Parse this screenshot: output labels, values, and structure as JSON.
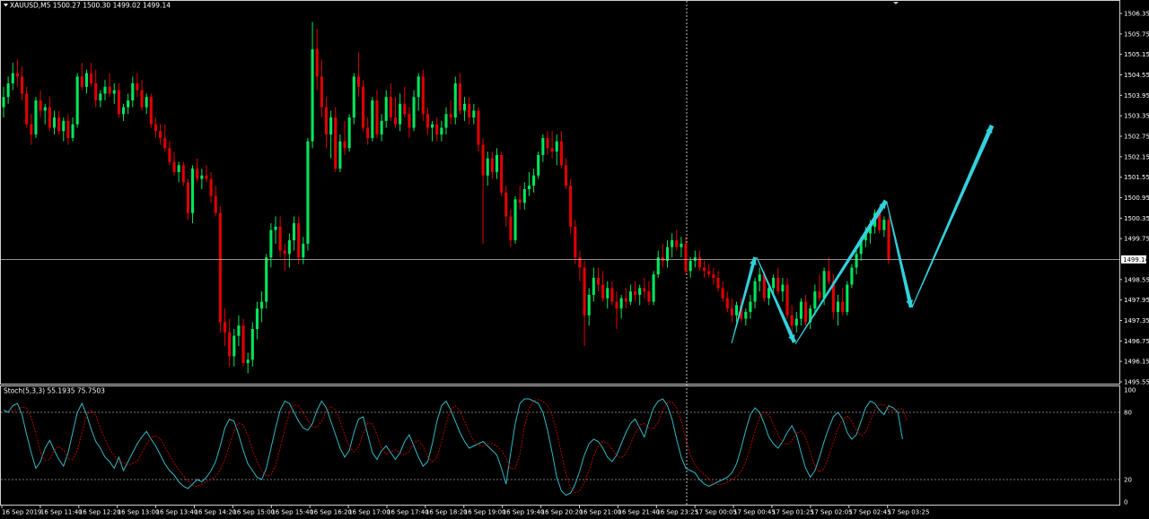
{
  "window": {
    "symbol_header": "XAUUSD,M5  1500.27 1500.30 1499.02 1499.14"
  },
  "colors": {
    "background": "#000000",
    "grid_frame": "#d0d0d0",
    "bull_candle": "#00e65c",
    "bear_candle": "#e00000",
    "price_line": "#c0c0c0",
    "crosshair": "#c0c0c0",
    "arrow": "#33d1de",
    "stoch_main": "#33b8c4",
    "stoch_signal": "#e00000",
    "bid_box": "#ffffff"
  },
  "main_panel": {
    "current_price_label": "1499.14",
    "price_axis_labels": [
      "1506.35",
      "1505.75",
      "1505.15",
      "1504.55",
      "1503.95",
      "1503.35",
      "1502.75",
      "1502.15",
      "1501.55",
      "1500.95",
      "1500.35",
      "1499.75",
      "1498.55",
      "1497.95",
      "1497.35",
      "1496.75",
      "1496.15",
      "1495.55"
    ],
    "annotation": "hand-drawn cyan zigzag arrow projection (down, up, down, up)"
  },
  "stoch_panel": {
    "header": "Stoch(5,3,3) 55.1935 75.7503",
    "axis_labels": [
      "100",
      "80",
      "20",
      "0"
    ]
  },
  "time_axis": {
    "labels": [
      "16 Sep 2019",
      "16 Sep 11:40",
      "16 Sep 12:20",
      "16 Sep 13:00",
      "16 Sep 13:40",
      "16 Sep 14:20",
      "16 Sep 15:00",
      "16 Sep 15:40",
      "16 Sep 16:20",
      "16 Sep 17:00",
      "16 Sep 17:40",
      "16 Sep 18:20",
      "16 Sep 19:00",
      "16 Sep 19:40",
      "16 Sep 20:20",
      "16 Sep 21:00",
      "16 Sep 21:40",
      "16 Sep 23:25",
      "17 Sep 00:05",
      "17 Sep 00:45",
      "17 Sep 01:25",
      "17 Sep 02:05",
      "17 Sep 02:45",
      "17 Sep 03:25"
    ]
  },
  "chart_data": {
    "type": "candlestick",
    "symbol": "XAUUSD",
    "timeframe": "M5",
    "ylim": [
      1495.55,
      1506.55
    ],
    "stoch_ylim": [
      0,
      100
    ],
    "stoch_levels": [
      80,
      20
    ],
    "ohlc": [
      [
        1503.6,
        1504.2,
        1503.3,
        1503.9
      ],
      [
        1503.9,
        1504.5,
        1503.7,
        1504.3
      ],
      [
        1504.3,
        1504.9,
        1504.1,
        1504.6
      ],
      [
        1504.6,
        1505.0,
        1504.2,
        1504.5
      ],
      [
        1504.5,
        1504.8,
        1503.8,
        1504.0
      ],
      [
        1504.0,
        1504.2,
        1503.0,
        1503.1
      ],
      [
        1503.1,
        1503.4,
        1502.5,
        1502.8
      ],
      [
        1502.8,
        1503.9,
        1502.7,
        1503.8
      ],
      [
        1503.8,
        1504.1,
        1503.3,
        1503.5
      ],
      [
        1503.5,
        1503.7,
        1503.1,
        1503.6
      ],
      [
        1503.6,
        1503.9,
        1502.9,
        1503.0
      ],
      [
        1503.0,
        1503.5,
        1502.8,
        1503.3
      ],
      [
        1503.3,
        1503.5,
        1502.8,
        1502.9
      ],
      [
        1502.9,
        1503.3,
        1502.6,
        1503.2
      ],
      [
        1503.2,
        1503.4,
        1502.5,
        1502.7
      ],
      [
        1502.7,
        1503.3,
        1502.6,
        1503.1
      ],
      [
        1503.1,
        1504.6,
        1503.0,
        1504.5
      ],
      [
        1504.5,
        1504.9,
        1504.1,
        1504.2
      ],
      [
        1504.2,
        1504.7,
        1504.0,
        1504.6
      ],
      [
        1504.6,
        1504.9,
        1504.2,
        1504.3
      ],
      [
        1504.3,
        1504.7,
        1503.6,
        1503.8
      ],
      [
        1503.8,
        1504.1,
        1503.6,
        1504.0
      ],
      [
        1504.0,
        1504.4,
        1503.8,
        1504.2
      ],
      [
        1504.2,
        1504.6,
        1503.9,
        1504.0
      ],
      [
        1504.0,
        1504.3,
        1503.7,
        1504.1
      ],
      [
        1504.1,
        1504.3,
        1503.3,
        1503.4
      ],
      [
        1503.4,
        1503.7,
        1503.2,
        1503.6
      ],
      [
        1503.6,
        1504.0,
        1503.4,
        1503.8
      ],
      [
        1503.8,
        1504.5,
        1503.6,
        1504.3
      ],
      [
        1504.3,
        1504.6,
        1503.9,
        1504.1
      ],
      [
        1504.1,
        1504.4,
        1503.5,
        1503.6
      ],
      [
        1503.6,
        1504.0,
        1503.4,
        1503.9
      ],
      [
        1503.9,
        1504.0,
        1503.0,
        1503.1
      ],
      [
        1503.1,
        1503.3,
        1502.7,
        1502.9
      ],
      [
        1502.9,
        1503.1,
        1502.5,
        1502.7
      ],
      [
        1502.7,
        1503.1,
        1502.3,
        1502.4
      ],
      [
        1502.4,
        1502.6,
        1501.9,
        1502.0
      ],
      [
        1502.0,
        1502.3,
        1501.6,
        1501.7
      ],
      [
        1501.7,
        1502.0,
        1501.4,
        1501.9
      ],
      [
        1501.9,
        1502.0,
        1501.3,
        1501.4
      ],
      [
        1501.4,
        1501.5,
        1500.3,
        1500.5
      ],
      [
        1500.5,
        1501.9,
        1500.2,
        1501.8
      ],
      [
        1501.8,
        1502.1,
        1501.4,
        1501.5
      ],
      [
        1501.5,
        1501.8,
        1501.2,
        1501.6
      ],
      [
        1501.6,
        1501.9,
        1501.4,
        1501.5
      ],
      [
        1501.5,
        1501.7,
        1500.8,
        1501.0
      ],
      [
        1501.0,
        1501.3,
        1500.4,
        1500.5
      ],
      [
        1500.5,
        1500.7,
        1497.0,
        1497.3
      ],
      [
        1497.3,
        1497.7,
        1496.6,
        1497.0
      ],
      [
        1497.0,
        1497.4,
        1496.0,
        1496.3
      ],
      [
        1496.3,
        1497.1,
        1496.0,
        1496.9
      ],
      [
        1496.9,
        1497.5,
        1496.6,
        1497.2
      ],
      [
        1497.2,
        1497.4,
        1496.0,
        1496.1
      ],
      [
        1496.1,
        1496.4,
        1495.8,
        1496.2
      ],
      [
        1496.2,
        1497.3,
        1496.0,
        1497.1
      ],
      [
        1497.1,
        1497.9,
        1496.8,
        1497.7
      ],
      [
        1497.7,
        1498.2,
        1497.3,
        1497.9
      ],
      [
        1497.9,
        1499.3,
        1497.7,
        1499.2
      ],
      [
        1499.2,
        1500.2,
        1498.9,
        1500.0
      ],
      [
        1500.0,
        1500.4,
        1499.6,
        1500.1
      ],
      [
        1500.1,
        1500.4,
        1499.2,
        1499.4
      ],
      [
        1499.4,
        1499.6,
        1498.8,
        1499.3
      ],
      [
        1499.3,
        1499.9,
        1498.9,
        1499.7
      ],
      [
        1499.7,
        1500.4,
        1499.4,
        1500.2
      ],
      [
        1500.2,
        1500.4,
        1499.0,
        1499.2
      ],
      [
        1499.2,
        1499.8,
        1499.0,
        1499.6
      ],
      [
        1499.6,
        1502.7,
        1499.4,
        1502.6
      ],
      [
        1502.6,
        1506.1,
        1502.4,
        1505.3
      ],
      [
        1505.3,
        1505.9,
        1504.1,
        1504.5
      ],
      [
        1504.5,
        1505.0,
        1503.3,
        1503.6
      ],
      [
        1503.6,
        1503.9,
        1502.4,
        1502.8
      ],
      [
        1502.8,
        1503.5,
        1502.1,
        1503.3
      ],
      [
        1503.3,
        1503.6,
        1501.7,
        1501.8
      ],
      [
        1501.8,
        1502.8,
        1501.7,
        1502.6
      ],
      [
        1502.6,
        1503.2,
        1502.2,
        1502.4
      ],
      [
        1502.4,
        1503.4,
        1502.3,
        1503.3
      ],
      [
        1503.3,
        1504.6,
        1503.1,
        1504.5
      ],
      [
        1504.5,
        1505.2,
        1503.9,
        1504.2
      ],
      [
        1504.2,
        1504.4,
        1502.9,
        1503.0
      ],
      [
        1503.0,
        1503.3,
        1502.5,
        1502.7
      ],
      [
        1502.7,
        1503.9,
        1502.6,
        1503.8
      ],
      [
        1503.8,
        1504.1,
        1502.7,
        1502.8
      ],
      [
        1502.8,
        1503.4,
        1502.6,
        1503.2
      ],
      [
        1503.2,
        1504.1,
        1503.0,
        1503.9
      ],
      [
        1503.9,
        1504.3,
        1503.2,
        1503.3
      ],
      [
        1503.3,
        1503.9,
        1503.0,
        1503.1
      ],
      [
        1503.1,
        1504.0,
        1502.9,
        1503.7
      ],
      [
        1503.7,
        1504.2,
        1503.3,
        1503.4
      ],
      [
        1503.4,
        1503.6,
        1502.7,
        1503.0
      ],
      [
        1503.0,
        1504.1,
        1502.9,
        1503.9
      ],
      [
        1503.9,
        1504.6,
        1503.5,
        1504.5
      ],
      [
        1504.5,
        1504.7,
        1503.2,
        1503.4
      ],
      [
        1503.4,
        1503.6,
        1502.8,
        1503.0
      ],
      [
        1503.0,
        1503.2,
        1502.6,
        1503.1
      ],
      [
        1503.1,
        1503.3,
        1502.6,
        1502.8
      ],
      [
        1502.8,
        1503.2,
        1502.6,
        1503.0
      ],
      [
        1503.0,
        1503.6,
        1502.8,
        1503.4
      ],
      [
        1503.4,
        1503.8,
        1503.1,
        1503.3
      ],
      [
        1503.3,
        1504.5,
        1503.1,
        1504.3
      ],
      [
        1504.3,
        1504.6,
        1503.4,
        1503.5
      ],
      [
        1503.5,
        1503.9,
        1503.2,
        1503.7
      ],
      [
        1503.7,
        1503.9,
        1503.1,
        1503.3
      ],
      [
        1503.3,
        1503.7,
        1503.1,
        1503.5
      ],
      [
        1503.5,
        1503.6,
        1502.3,
        1502.5
      ],
      [
        1502.5,
        1502.7,
        1499.6,
        1501.6
      ],
      [
        1501.6,
        1502.3,
        1501.3,
        1502.1
      ],
      [
        1502.1,
        1502.3,
        1501.5,
        1501.7
      ],
      [
        1501.7,
        1502.4,
        1501.5,
        1502.2
      ],
      [
        1502.2,
        1502.3,
        1501.0,
        1501.1
      ],
      [
        1501.1,
        1501.3,
        1500.1,
        1500.4
      ],
      [
        1500.4,
        1500.6,
        1499.5,
        1499.7
      ],
      [
        1499.7,
        1501.0,
        1499.6,
        1500.9
      ],
      [
        1500.9,
        1501.3,
        1500.6,
        1500.8
      ],
      [
        1500.8,
        1501.4,
        1500.6,
        1501.2
      ],
      [
        1501.2,
        1501.7,
        1501.0,
        1501.3
      ],
      [
        1501.3,
        1501.8,
        1501.1,
        1501.6
      ],
      [
        1501.6,
        1502.3,
        1501.5,
        1502.2
      ],
      [
        1502.2,
        1502.8,
        1502.0,
        1502.7
      ],
      [
        1502.7,
        1502.9,
        1502.2,
        1502.4
      ],
      [
        1502.4,
        1502.9,
        1502.1,
        1502.3
      ],
      [
        1502.3,
        1502.8,
        1501.9,
        1502.6
      ],
      [
        1502.6,
        1502.9,
        1501.8,
        1501.9
      ],
      [
        1501.9,
        1502.1,
        1501.2,
        1501.3
      ],
      [
        1501.3,
        1501.5,
        1499.9,
        1500.1
      ],
      [
        1500.1,
        1500.3,
        1499.0,
        1499.2
      ],
      [
        1499.2,
        1499.4,
        1498.5,
        1498.9
      ],
      [
        1498.9,
        1499.1,
        1496.6,
        1497.5
      ],
      [
        1497.5,
        1498.3,
        1497.2,
        1498.1
      ],
      [
        1498.1,
        1498.9,
        1497.9,
        1498.6
      ],
      [
        1498.6,
        1498.9,
        1498.2,
        1498.4
      ],
      [
        1498.4,
        1498.8,
        1497.9,
        1498.0
      ],
      [
        1498.0,
        1498.5,
        1497.7,
        1498.3
      ],
      [
        1498.3,
        1498.5,
        1497.8,
        1497.9
      ],
      [
        1497.9,
        1498.2,
        1497.1,
        1497.7
      ],
      [
        1497.7,
        1498.1,
        1497.4,
        1498.0
      ],
      [
        1498.0,
        1498.3,
        1497.7,
        1497.9
      ],
      [
        1497.9,
        1498.4,
        1497.8,
        1498.2
      ],
      [
        1498.2,
        1498.5,
        1497.9,
        1498.1
      ],
      [
        1498.1,
        1498.4,
        1497.8,
        1498.3
      ],
      [
        1498.3,
        1498.6,
        1498.0,
        1498.2
      ],
      [
        1498.2,
        1498.5,
        1497.8,
        1497.9
      ],
      [
        1497.9,
        1498.8,
        1497.8,
        1498.7
      ],
      [
        1498.7,
        1499.4,
        1498.6,
        1499.2
      ],
      [
        1499.2,
        1499.6,
        1498.9,
        1499.1
      ],
      [
        1499.1,
        1499.7,
        1498.9,
        1499.5
      ],
      [
        1499.5,
        1499.9,
        1499.2,
        1499.7
      ],
      [
        1499.7,
        1500.0,
        1499.4,
        1499.5
      ],
      [
        1499.5,
        1499.8,
        1499.2,
        1499.6
      ],
      [
        1499.6,
        1499.8,
        1498.7,
        1498.8
      ],
      [
        1498.8,
        1499.2,
        1498.6,
        1499.1
      ],
      [
        1499.1,
        1499.4,
        1498.9,
        1499.2
      ],
      [
        1499.2,
        1499.4,
        1498.8,
        1498.9
      ],
      [
        1498.9,
        1499.1,
        1498.6,
        1498.8
      ],
      [
        1498.8,
        1499.0,
        1498.6,
        1498.7
      ],
      [
        1498.7,
        1498.9,
        1498.4,
        1498.6
      ],
      [
        1498.6,
        1498.8,
        1498.2,
        1498.3
      ],
      [
        1498.3,
        1498.5,
        1497.9,
        1498.0
      ],
      [
        1498.0,
        1498.2,
        1497.6,
        1497.7
      ],
      [
        1497.7,
        1498.0,
        1497.3,
        1497.5
      ],
      [
        1497.5,
        1497.9,
        1497.3,
        1497.8
      ],
      [
        1497.8,
        1498.0,
        1497.3,
        1497.4
      ],
      [
        1497.4,
        1497.7,
        1497.2,
        1497.6
      ],
      [
        1497.6,
        1498.1,
        1497.4,
        1497.9
      ],
      [
        1497.9,
        1498.6,
        1497.7,
        1498.5
      ],
      [
        1498.5,
        1498.9,
        1498.2,
        1498.7
      ],
      [
        1498.7,
        1498.8,
        1497.9,
        1498.0
      ],
      [
        1498.0,
        1498.4,
        1497.8,
        1498.3
      ],
      [
        1498.3,
        1498.7,
        1498.1,
        1498.6
      ],
      [
        1498.6,
        1498.9,
        1498.1,
        1498.2
      ],
      [
        1498.2,
        1498.6,
        1497.9,
        1498.4
      ],
      [
        1498.4,
        1498.6,
        1497.4,
        1497.5
      ],
      [
        1497.5,
        1497.8,
        1497.0,
        1497.2
      ],
      [
        1497.2,
        1497.6,
        1497.0,
        1497.4
      ],
      [
        1497.4,
        1498.0,
        1497.2,
        1497.9
      ],
      [
        1497.9,
        1498.1,
        1497.2,
        1497.3
      ],
      [
        1497.3,
        1497.8,
        1497.1,
        1497.7
      ],
      [
        1497.7,
        1498.4,
        1497.5,
        1498.2
      ],
      [
        1498.2,
        1498.7,
        1497.9,
        1498.0
      ],
      [
        1498.0,
        1498.9,
        1497.8,
        1498.8
      ],
      [
        1498.8,
        1499.2,
        1498.4,
        1498.5
      ],
      [
        1498.5,
        1498.7,
        1497.4,
        1497.6
      ],
      [
        1497.6,
        1498.1,
        1497.2,
        1497.9
      ],
      [
        1497.9,
        1498.3,
        1497.5,
        1497.6
      ],
      [
        1497.6,
        1498.5,
        1497.5,
        1498.4
      ],
      [
        1498.4,
        1499.0,
        1498.3,
        1498.9
      ],
      [
        1498.9,
        1499.4,
        1498.7,
        1499.3
      ],
      [
        1499.3,
        1499.8,
        1499.1,
        1499.7
      ],
      [
        1499.7,
        1500.1,
        1499.5,
        1499.9
      ],
      [
        1499.9,
        1500.3,
        1499.6,
        1500.1
      ],
      [
        1500.1,
        1500.6,
        1499.9,
        1500.5
      ],
      [
        1500.5,
        1500.7,
        1499.9,
        1500.0
      ],
      [
        1500.0,
        1500.4,
        1499.8,
        1500.3
      ],
      [
        1500.3,
        1500.4,
        1499.0,
        1499.14
      ]
    ],
    "stoch_main": [
      82,
      80,
      86,
      88,
      78,
      60,
      44,
      30,
      36,
      48,
      55,
      46,
      38,
      32,
      44,
      62,
      80,
      88,
      78,
      65,
      54,
      48,
      40,
      36,
      30,
      40,
      28,
      36,
      44,
      52,
      58,
      63,
      56,
      50,
      42,
      34,
      28,
      24,
      18,
      14,
      12,
      16,
      20,
      18,
      22,
      28,
      36,
      50,
      66,
      74,
      72,
      60,
      46,
      34,
      28,
      22,
      20,
      30,
      48,
      66,
      82,
      90,
      88,
      80,
      72,
      66,
      64,
      70,
      82,
      90,
      84,
      72,
      60,
      48,
      40,
      46,
      62,
      74,
      76,
      60,
      44,
      38,
      46,
      50,
      44,
      38,
      44,
      54,
      60,
      50,
      40,
      32,
      36,
      52,
      72,
      86,
      90,
      82,
      72,
      62,
      54,
      48,
      50,
      52,
      54,
      50,
      46,
      42,
      30,
      16,
      44,
      70,
      88,
      92,
      92,
      90,
      88,
      80,
      64,
      44,
      22,
      10,
      6,
      8,
      16,
      28,
      42,
      52,
      56,
      54,
      48,
      40,
      36,
      42,
      52,
      62,
      70,
      74,
      66,
      58,
      72,
      84,
      90,
      92,
      86,
      74,
      56,
      40,
      30,
      28,
      26,
      20,
      16,
      14,
      16,
      18,
      20,
      22,
      26,
      34,
      48,
      64,
      78,
      84,
      80,
      70,
      58,
      52,
      48,
      54,
      62,
      68,
      60,
      44,
      30,
      22,
      28,
      40,
      54,
      66,
      76,
      80,
      74,
      62,
      56,
      60,
      72,
      84,
      90,
      88,
      82,
      78,
      86,
      84,
      80,
      56
    ]
  }
}
